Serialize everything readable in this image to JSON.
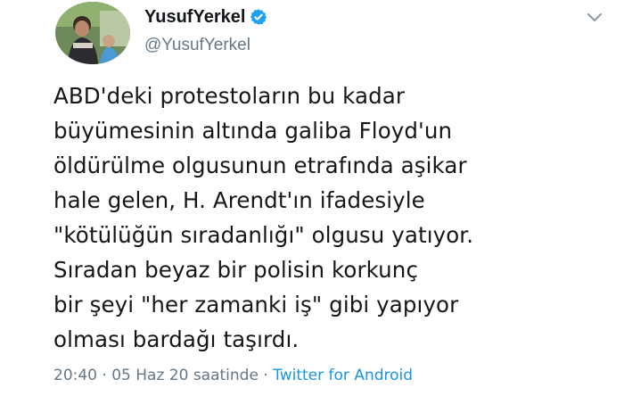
{
  "author": {
    "display_name": "YusufYerkel",
    "handle": "@YusufYerkel",
    "verified": true,
    "avatar_icon": "profile-photo"
  },
  "tweet": {
    "lines": [
      "ABD'deki protestoların bu kadar",
      "büyümesinin altında galiba Floyd'un",
      "öldürülme olgusunun etrafında aşikar",
      "hale gelen, H. Arendt'ın ifadesiyle",
      "\"kötülüğün sıradanlığı\" olgusu yatıyor.",
      "Sıradan beyaz bir polisin korkunç",
      "bir şeyi \"her zamanki iş\" gibi yapıyor",
      "olması bardağı taşırdı."
    ]
  },
  "meta": {
    "time": "20:40",
    "separator": " · ",
    "date": "05 Haz 20 saatinde",
    "source": "Twitter for Android"
  },
  "colors": {
    "text": "#14171a",
    "secondary": "#657786",
    "link": "#1b95e0",
    "verified": "#1da1f2"
  },
  "icons": {
    "verified": "verified-badge-icon",
    "menu": "chevron-down-icon"
  }
}
